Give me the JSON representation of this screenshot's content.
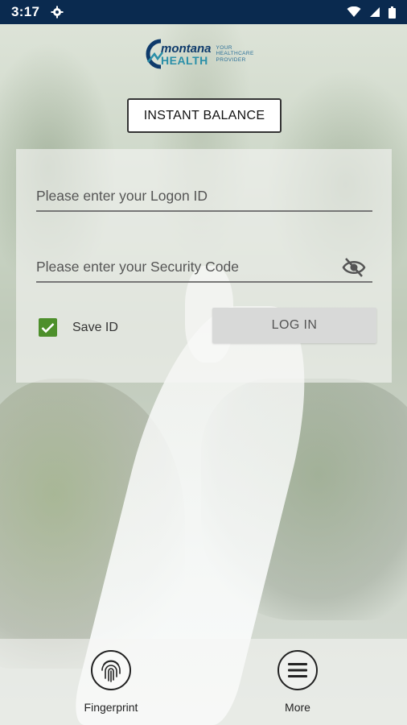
{
  "status_bar": {
    "time": "3:17",
    "icons": [
      "gear-icon",
      "wifi-icon",
      "signal-icon",
      "battery-icon"
    ]
  },
  "logo": {
    "brand_line1": "montana",
    "brand_line2": "HEALTH",
    "tagline_1": "YOUR",
    "tagline_2": "HEALTHCARE",
    "tagline_3": "PROVIDER"
  },
  "instant_balance": {
    "label": "INSTANT BALANCE"
  },
  "login": {
    "logon_placeholder": "Please enter your Logon ID",
    "logon_value": "",
    "code_placeholder": "Please enter your Security Code",
    "code_value": "",
    "save_id_label": "Save ID",
    "save_id_checked": true,
    "login_label": "LOG IN"
  },
  "bottom_bar": {
    "fingerprint_label": "Fingerprint",
    "more_label": "More"
  },
  "colors": {
    "status_bar": "#0a2a4f",
    "checkbox": "#4d8f2b",
    "login_button": "#d8d9d8"
  }
}
